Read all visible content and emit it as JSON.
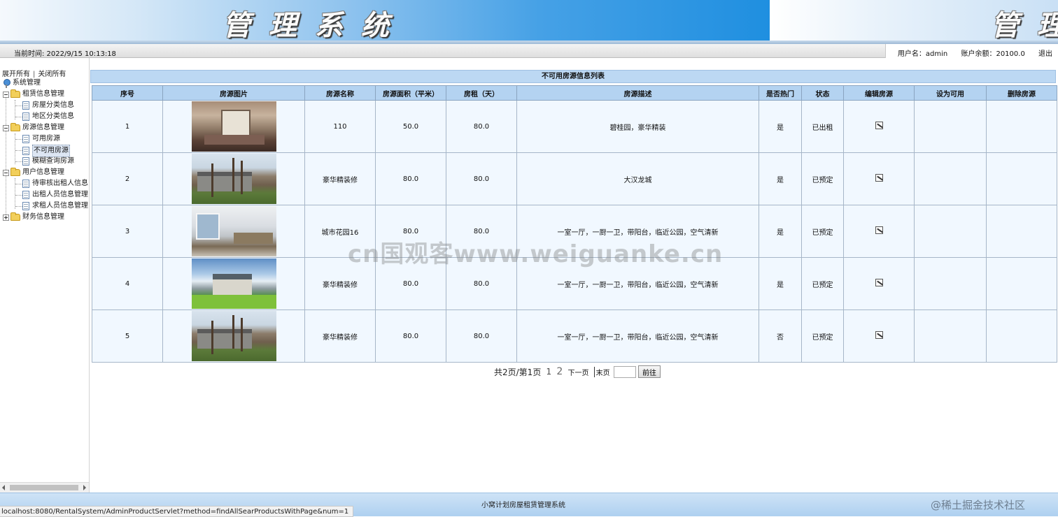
{
  "banner": {
    "title_main": "管理系统",
    "title_repeat": "管理"
  },
  "status": {
    "current_time": "当前时间: 2022/9/15 10:13:18",
    "username": "用户名：admin",
    "balance": "账户余额：20100.0",
    "logout": "退出"
  },
  "sidebar": {
    "expand_all": "展开所有",
    "separator": "|",
    "collapse_all": "关闭所有",
    "root": "系统管理",
    "groups": [
      {
        "label": "租赁信息管理",
        "items": [
          "房屋分类信息",
          "地区分类信息"
        ]
      },
      {
        "label": "房源信息管理",
        "items": [
          "可用房源",
          "不可用房源",
          "模糊查询房源"
        ]
      },
      {
        "label": "用户信息管理",
        "items": [
          "待审核出租人信息",
          "出租人员信息管理",
          "求租人员信息管理"
        ]
      },
      {
        "label": "财务信息管理",
        "items": []
      }
    ],
    "selected_item": "不可用房源"
  },
  "table": {
    "caption": "不可用房源信息列表",
    "headers": [
      "序号",
      "房源图片",
      "房源名称",
      "房源面积（平米）",
      "房租（天）",
      "房源描述",
      "是否热门",
      "状态",
      "编辑房源",
      "设为可用",
      "删除房源"
    ],
    "rows": [
      {
        "no": "1",
        "image": "living-room-photo",
        "name": "110",
        "area": "50.0",
        "rent": "80.0",
        "desc": "碧桂园，豪华精装",
        "hot": "是",
        "status": "已出租"
      },
      {
        "no": "2",
        "image": "house-exterior-photo",
        "name": "豪华精装修",
        "area": "80.0",
        "rent": "80.0",
        "desc": "大汉龙城",
        "hot": "是",
        "status": "已预定"
      },
      {
        "no": "3",
        "image": "modern-living-photo",
        "name": "城市花园16",
        "area": "80.0",
        "rent": "80.0",
        "desc": "一室一厅，一厨一卫，带阳台，临近公园，空气清新",
        "hot": "是",
        "status": "已预定"
      },
      {
        "no": "4",
        "image": "villa-lawn-photo",
        "name": "豪华精装修",
        "area": "80.0",
        "rent": "80.0",
        "desc": "一室一厅，一厨一卫，带阳台，临近公园，空气清新",
        "hot": "是",
        "status": "已预定"
      },
      {
        "no": "5",
        "image": "house-exterior-photo",
        "name": "豪华精装修",
        "area": "80.0",
        "rent": "80.0",
        "desc": "一室一厅，一厨一卫，带阳台，临近公园，空气清新",
        "hot": "否",
        "status": "已预定"
      }
    ],
    "edit_icon": "edit-icon"
  },
  "pagination": {
    "summary": "共2页/第1页",
    "page_1": "1",
    "page_2": "2",
    "next": "下一页",
    "last": "末页",
    "input_value": "",
    "go_button": "前往"
  },
  "watermark": "cn国观客www.weiguanke.cn",
  "footer": {
    "title": "小窝计划房屋租赁管理系统",
    "status_url": "localhost:8080/RentalSystem/AdminProductServlet?method=findAllSearProductsWithPage&num=1",
    "site_badge": "@稀土掘金技术社区"
  }
}
